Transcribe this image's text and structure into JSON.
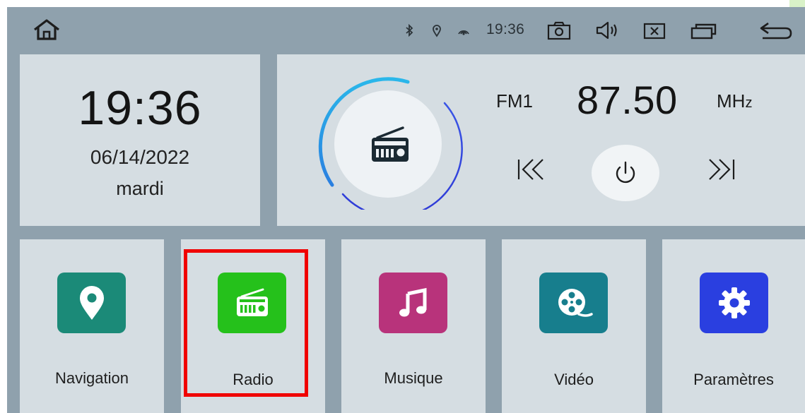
{
  "status_bar": {
    "time": "19:36",
    "icons": [
      "home-icon",
      "bluetooth-icon",
      "location-icon",
      "signal-icon",
      "camera-icon",
      "volume-icon",
      "close-box-icon",
      "windows-icon",
      "back-icon"
    ]
  },
  "clock_widget": {
    "time": "19:36",
    "date": "06/14/2022",
    "day": "mardi"
  },
  "radio_widget": {
    "band": "FM1",
    "frequency": "87.50",
    "unit_main": "MH",
    "unit_sub": "z",
    "controls": [
      "previous-icon",
      "power-icon",
      "next-icon"
    ]
  },
  "apps": [
    {
      "label": "Navigation",
      "icon": "location-pin-icon",
      "color": "#1b8a78"
    },
    {
      "label": "Radio",
      "icon": "radio-icon",
      "color": "#25c11b"
    },
    {
      "label": "Musique",
      "icon": "music-note-icon",
      "color": "#b8337b"
    },
    {
      "label": "Vidéo",
      "icon": "film-reel-icon",
      "color": "#177e8d"
    },
    {
      "label": "Paramètres",
      "icon": "gear-icon",
      "color": "#2a3fe0"
    }
  ],
  "highlight_color": "#f00000"
}
